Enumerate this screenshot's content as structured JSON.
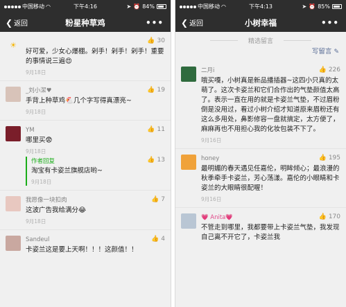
{
  "left": {
    "status": {
      "carrier": "中国移动",
      "time": "下午4:16",
      "battery": "84%",
      "battery_level": 0.84
    },
    "nav": {
      "back": "返回",
      "title": "粉星种草鸡",
      "more": "•••"
    },
    "comments": [
      {
        "name": "",
        "avatar_icon": "sun-icon",
        "avatar_glyph": "☀",
        "avatar_bg": "#ffffff",
        "avatar_color": "#f5b400",
        "likes": "30",
        "text": "好可爱，少女心爆棚。剁手！剁手！剁手！重要的事情说三遍😍",
        "date": "9月18日"
      },
      {
        "name": "_刘小潔♥",
        "avatar_icon": "user-avatar-icon",
        "avatar_glyph": "",
        "avatar_bg": "#d8c3b9",
        "avatar_color": "#fff",
        "likes": "19",
        "text": "手背上种草鸡🐔几个字写得真漂亮~",
        "date": "9月18日"
      },
      {
        "name": "YM",
        "avatar_icon": "user-avatar-icon",
        "avatar_glyph": "",
        "avatar_bg": "#7a1e2a",
        "avatar_color": "#fff",
        "likes": "11",
        "text": "哪里买😨",
        "date": "9月18日",
        "reply": {
          "label": "作者回复",
          "likes": "13",
          "text": "淘宝有卡姿兰旗舰店哟~",
          "date": "9月18日"
        }
      },
      {
        "name": "我愿像一块扣肉",
        "avatar_icon": "user-avatar-icon",
        "avatar_glyph": "",
        "avatar_bg": "#e8c8c0",
        "avatar_color": "#fff",
        "likes": "7",
        "text": "这波广告我给满分😂",
        "date": "9月18日"
      },
      {
        "name": "Sandeul",
        "avatar_icon": "user-avatar-icon",
        "avatar_glyph": "",
        "avatar_bg": "#c9a8a0",
        "avatar_color": "#fff",
        "likes": "4",
        "text": "卡姿兰这是要上天啊！！！这颜值！！",
        "date": ""
      }
    ]
  },
  "right": {
    "status": {
      "carrier": "中国移动",
      "time": "下午4:13",
      "battery": "85%",
      "battery_level": 0.85
    },
    "nav": {
      "back": "返回",
      "title": "小树幸福",
      "more": "•••"
    },
    "section_title": "精选留言",
    "write_label": "写留言",
    "comments": [
      {
        "name": "二月i",
        "avatar_icon": "user-avatar-icon",
        "avatar_glyph": "",
        "avatar_bg": "#2f6b3e",
        "avatar_color": "#fff",
        "likes": "226",
        "text": "哦买嘎，小树真是新品播插器~这四小只真的太萌了。这次卡姿兰和它们合作出的气垫颜值太高了。表示一直在用的就是卡姿兰气垫，不过眉粉倒是没用过，看过小树介绍才知道原来眉粉还有这么多用处，鼻影修容一盘就搞定，太方便了，麻麻再也不用担心我的化妆包装不下了。",
        "date": "9月16日"
      },
      {
        "name": "honey",
        "avatar_icon": "user-avatar-icon",
        "avatar_glyph": "",
        "avatar_bg": "#f0a23a",
        "avatar_color": "#fff",
        "likes": "195",
        "text": "最明媚的春天遇见任嘉伦，明眸倾心；最浪漫的秋季牵手卡姿兰，芳心荡漾。嘉伦的小眼睛和卡姿兰的大眼睛很配喔！",
        "date": "9月16日"
      },
      {
        "name": "💗 Anita💗",
        "avatar_icon": "user-avatar-icon",
        "avatar_glyph": "",
        "avatar_bg": "#b9c6d4",
        "avatar_color": "#fff",
        "likes": "170",
        "text": "不管走到哪里，我都要带上卡姿兰气垫，我发现自己离不开它了，卡姿兰我",
        "date": ""
      }
    ]
  }
}
